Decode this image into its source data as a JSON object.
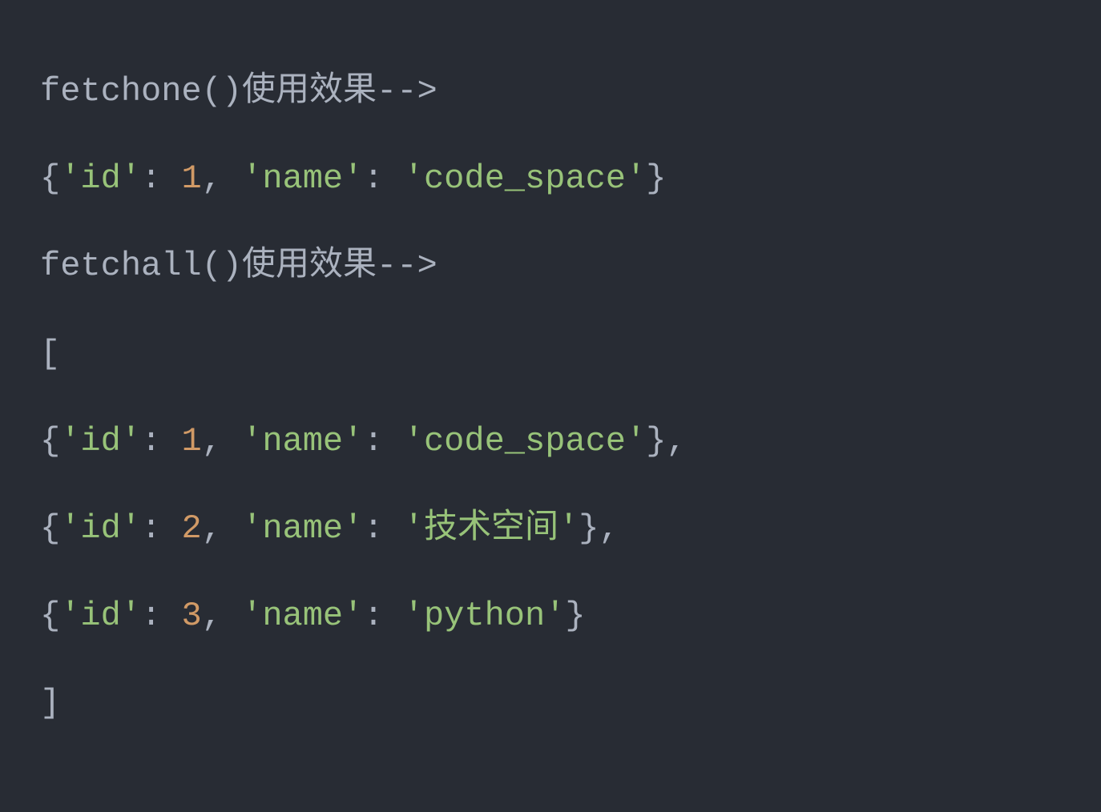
{
  "lines": {
    "l1": {
      "text": "fetchone()使用效果-->"
    },
    "l2": {
      "open": "{",
      "key1": "'id'",
      "colon1": ": ",
      "val1": "1",
      "comma1": ", ",
      "key2": "'name'",
      "colon2": ": ",
      "val2": "'code_space'",
      "close": "}"
    },
    "l3": {
      "text": "fetchall()使用效果-->"
    },
    "l4": {
      "text": "["
    },
    "l5": {
      "open": "{",
      "key1": "'id'",
      "colon1": ": ",
      "val1": "1",
      "comma1": ", ",
      "key2": "'name'",
      "colon2": ": ",
      "val2": "'code_space'",
      "close": "},"
    },
    "l6": {
      "open": "{",
      "key1": "'id'",
      "colon1": ": ",
      "val1": "2",
      "comma1": ", ",
      "key2": "'name'",
      "colon2": ": ",
      "val2": "'技术空间'",
      "close": "},"
    },
    "l7": {
      "open": "{",
      "key1": "'id'",
      "colon1": ": ",
      "val1": "3",
      "comma1": ", ",
      "key2": "'name'",
      "colon2": ": ",
      "val2": "'python'",
      "close": "}"
    },
    "l8": {
      "text": "]"
    }
  }
}
